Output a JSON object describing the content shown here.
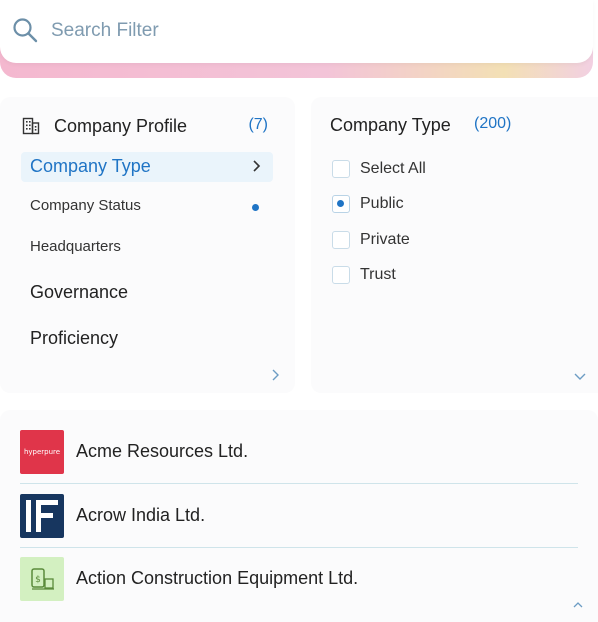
{
  "search": {
    "placeholder": "Search Filter",
    "value": ""
  },
  "left_panel": {
    "title": "Company Profile",
    "count": "(7)",
    "items": [
      {
        "label": "Company Type",
        "active": true
      },
      {
        "label": "Company Status",
        "has_dot": true
      },
      {
        "label": "Headquarters"
      },
      {
        "label": "Governance"
      },
      {
        "label": "Proficiency"
      }
    ]
  },
  "right_panel": {
    "title": "Company Type",
    "count": "(200)",
    "options": [
      {
        "label": "Select All",
        "checked": false
      },
      {
        "label": "Public",
        "checked": true
      },
      {
        "label": "Private",
        "checked": false
      },
      {
        "label": "Trust",
        "checked": false
      }
    ]
  },
  "companies": [
    {
      "name": "Acme Resources Ltd.",
      "logo_text": "hyperpure"
    },
    {
      "name": "Acrow India Ltd."
    },
    {
      "name": "Action Construction Equipment Ltd."
    }
  ],
  "colors": {
    "accent": "#1f74c5",
    "active_bg": "#eaf4fb",
    "gradient_pink": "#f4b8cf",
    "gradient_gold": "#f3e0b5"
  }
}
